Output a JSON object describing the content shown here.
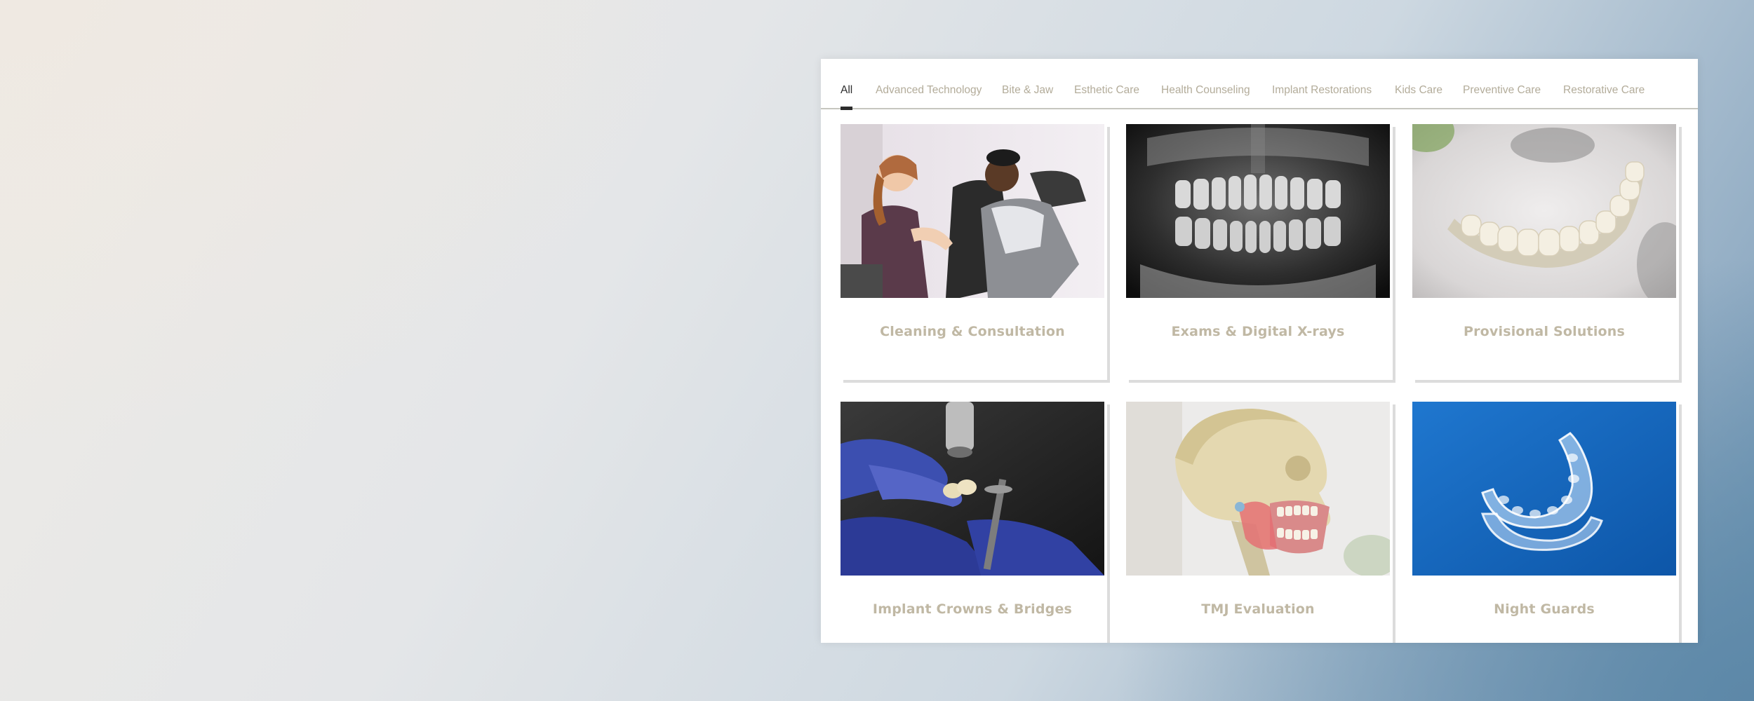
{
  "tabs": [
    {
      "label": "All",
      "active": true
    },
    {
      "label": "Advanced Technology",
      "active": false
    },
    {
      "label": "Bite & Jaw",
      "active": false
    },
    {
      "label": "Esthetic Care",
      "active": false
    },
    {
      "label": "Health Counseling",
      "active": false
    },
    {
      "label": "Implant Restorations",
      "active": false
    },
    {
      "label": "Kids Care",
      "active": false
    },
    {
      "label": "Preventive Care",
      "active": false
    },
    {
      "label": "Restorative Care",
      "active": false
    }
  ],
  "cards": [
    {
      "title": "Cleaning & Consultation"
    },
    {
      "title": "Exams & Digital X-rays"
    },
    {
      "title": "Provisional Solutions"
    },
    {
      "title": "Implant Crowns & Bridges"
    },
    {
      "title": "TMJ Evaluation"
    },
    {
      "title": "Night Guards"
    }
  ],
  "colors": {
    "tab_active": "#2c2c2c",
    "tab_inactive": "#b3ac9a",
    "card_title": "#c0b8a4",
    "nightguard_bg": "#1668c0"
  }
}
